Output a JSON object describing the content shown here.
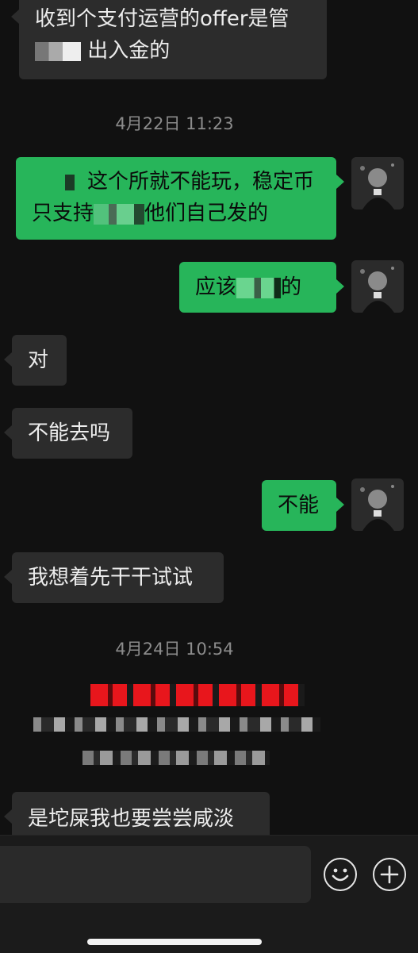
{
  "messages": [
    {
      "side": "in",
      "line1": "收到个支付运营的offer是管",
      "line2": "出入金的"
    },
    {
      "side": "time",
      "text": "4月22日 11:23"
    },
    {
      "side": "out",
      "line1_part": "这个所就不能玩，稳定币",
      "line2_prefix": "只支持",
      "line2_suffix": "他们自己发的"
    },
    {
      "side": "out",
      "prefix": "应该",
      "suffix": "的"
    },
    {
      "side": "in",
      "text": "对"
    },
    {
      "side": "in",
      "text": "不能去吗"
    },
    {
      "side": "out",
      "text": "不能"
    },
    {
      "side": "in",
      "text": "我想着先干干试试"
    },
    {
      "side": "time",
      "text": "4月24日 10:54"
    },
    {
      "side": "in",
      "text": "是坨屎我也要尝尝咸淡"
    }
  ],
  "colors": {
    "background": "#111111",
    "incoming_bubble": "#2c2c2c",
    "outgoing_bubble": "#27b55a",
    "redaction_red": "#e8161c"
  },
  "icons": {
    "emoji": "smiley-face-icon",
    "more": "plus-circle-icon"
  }
}
